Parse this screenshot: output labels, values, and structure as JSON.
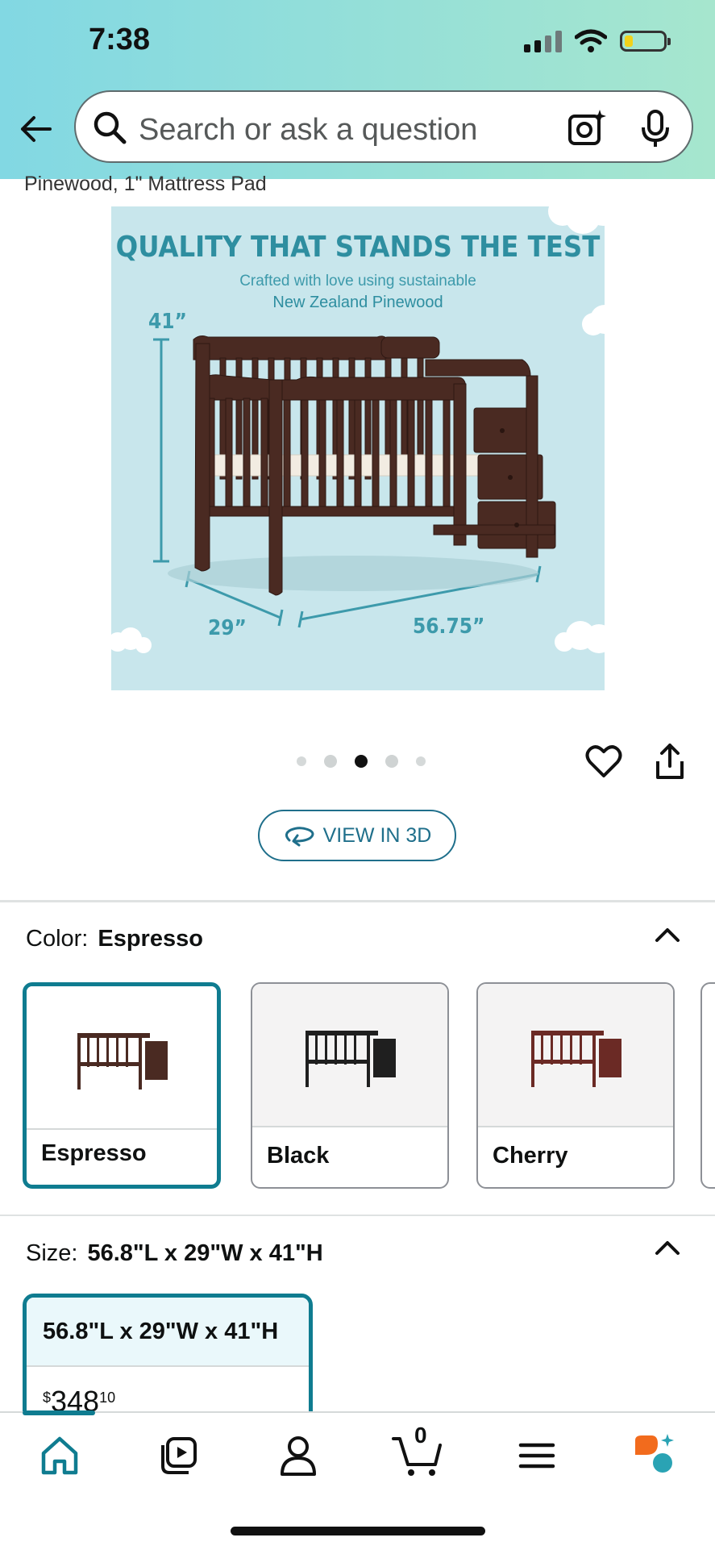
{
  "status_bar": {
    "time": "7:38"
  },
  "search": {
    "placeholder": "Search or ask a question"
  },
  "product": {
    "subtitle_fragment": "Pinewood, 1\" Mattress Pad",
    "hero": {
      "headline": "QUALITY THAT STANDS THE TEST",
      "line1": "Crafted with love using sustainable",
      "line2": "New Zealand Pinewood",
      "height": "41”",
      "depth": "29”",
      "width": "56.75”"
    },
    "carousel": {
      "count": 5,
      "active_index": 2
    },
    "view_3d_label": "VIEW IN 3D"
  },
  "color_section": {
    "label": "Color:",
    "selected": "Espresso",
    "options": [
      {
        "name": "Espresso",
        "color": "#4a2a22",
        "selected": true
      },
      {
        "name": "Black",
        "color": "#1f1f1f",
        "selected": false
      },
      {
        "name": "Cherry",
        "color": "#6b2a25",
        "selected": false
      }
    ]
  },
  "size_section": {
    "label": "Size:",
    "selected": "56.8\"L x 29\"W x 41\"H",
    "option": {
      "name": "56.8\"L x 29\"W x 41\"H",
      "price_symbol": "$",
      "price_whole": "348",
      "price_fraction": "10"
    }
  },
  "tab_bar": {
    "items": [
      {
        "icon": "home-icon",
        "active": true
      },
      {
        "icon": "video-icon"
      },
      {
        "icon": "account-icon"
      },
      {
        "icon": "cart-icon",
        "badge": "0"
      },
      {
        "icon": "menu-icon"
      },
      {
        "icon": "rufus-icon"
      }
    ]
  },
  "colors": {
    "accent": "#0f7c90",
    "link": "#1f6f8b",
    "hero_bg": "#c8e6ec",
    "header_start": "#82d8e3",
    "header_end": "#a6e6ce"
  }
}
